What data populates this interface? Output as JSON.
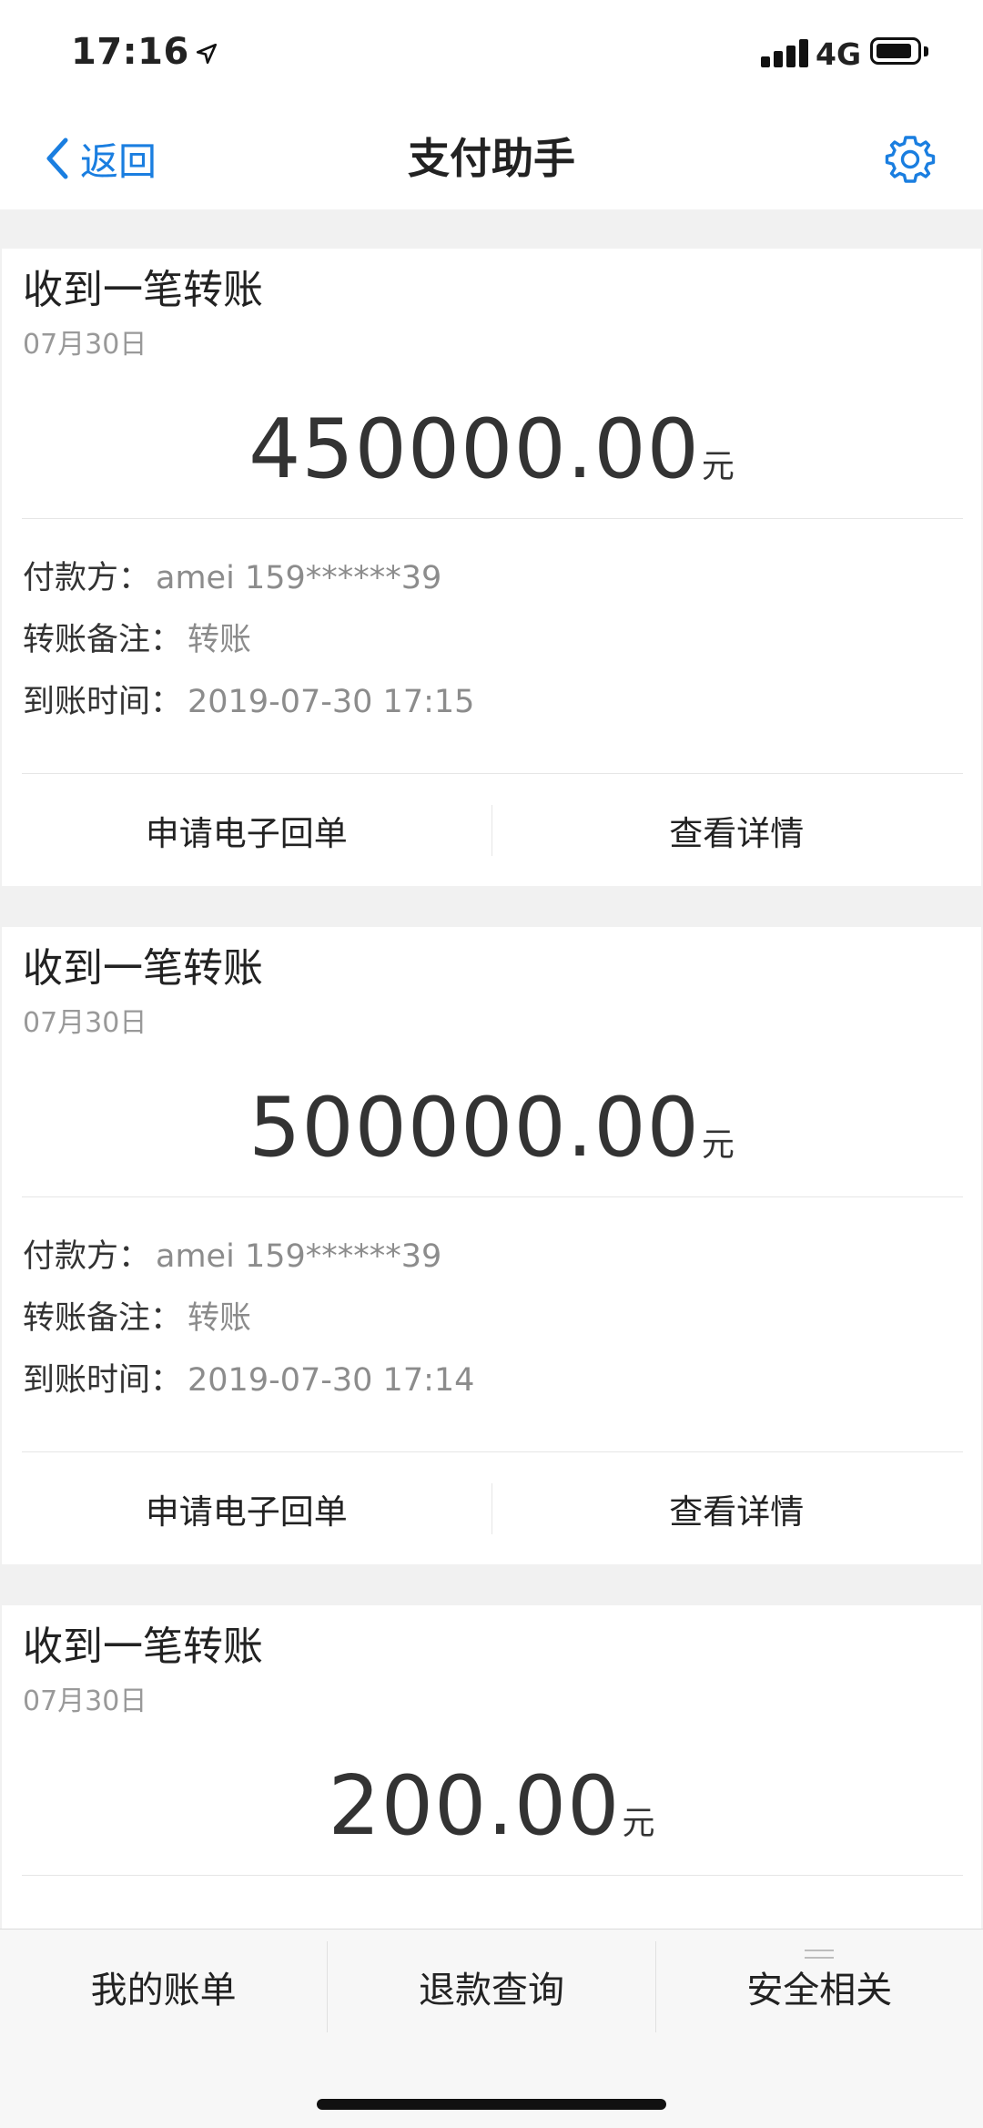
{
  "status_bar": {
    "time": "17:16",
    "network": "4G"
  },
  "nav": {
    "back_label": "返回",
    "title": "支付助手"
  },
  "cards": [
    {
      "title": "收到一笔转账",
      "date": "07月30日",
      "amount": "450000.00",
      "unit": "元",
      "payer_label": "付款方：",
      "payer": "amei 159******39",
      "note_label": "转账备注：",
      "note": "转账",
      "time_label": "到账时间：",
      "time": "2019-07-30 17:15",
      "btn_receipt": "申请电子回单",
      "btn_detail": "查看详情"
    },
    {
      "title": "收到一笔转账",
      "date": "07月30日",
      "amount": "500000.00",
      "unit": "元",
      "payer_label": "付款方：",
      "payer": "amei 159******39",
      "note_label": "转账备注：",
      "note": "转账",
      "time_label": "到账时间：",
      "time": "2019-07-30 17:14",
      "btn_receipt": "申请电子回单",
      "btn_detail": "查看详情"
    },
    {
      "title": "收到一笔转账",
      "date": "07月30日",
      "amount": "200.00",
      "unit": "元"
    }
  ],
  "tabs": [
    "我的账单",
    "退款查询",
    "安全相关"
  ],
  "icons": {
    "back": "chevron-left-icon",
    "settings": "gear-icon",
    "location": "location-arrow-icon",
    "menu": "menu-lines-icon"
  },
  "colors": {
    "accent": "#1a7ee0",
    "background": "#f1f1f1",
    "muted": "#999999"
  }
}
